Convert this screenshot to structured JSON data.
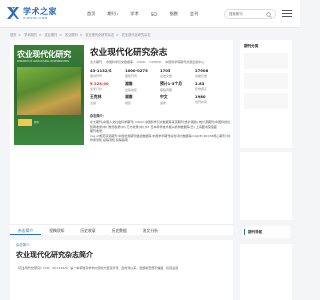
{
  "header": {
    "logo_cn": "学术之家",
    "logo_en": "XUESHU.COM",
    "nav": [
      {
        "label": "首页",
        "dropdown": false
      },
      {
        "label": "期刊",
        "dropdown": true
      },
      {
        "label": "学术",
        "dropdown": false
      },
      {
        "label": "SCI",
        "dropdown": false
      },
      {
        "label": "指数",
        "dropdown": false
      },
      {
        "label": "会刊",
        "dropdown": false
      }
    ],
    "search_placeholder": "搜索期刊"
  },
  "breadcrumb": [
    "首页",
    "学术期刊",
    "农业期刊",
    "农业期刊",
    "农业现代化研究杂志",
    "农业现代化研究杂志"
  ],
  "journal": {
    "title": "农业现代化研究杂志",
    "tags": [
      "北大期刊",
      "中国科学引文数据库",
      "CSCD",
      "CSTPCD",
      "中国科学院期刊文献出版中心"
    ],
    "cover_title": "农业现代化研究",
    "cover_sub": "RESEARCH OF AGRICULTURAL MODERNIZATION",
    "cover_band": "期刊",
    "stats": [
      {
        "value": "43-1132/S",
        "label": "国内刊号"
      },
      {
        "value": "1000-0275",
        "label": "国际刊号"
      },
      {
        "value": "1705",
        "label": "总发文量"
      },
      {
        "value": "27908",
        "label": "总被引量"
      },
      {
        "value": "¥ 228.00",
        "label": "全年订价",
        "red": true
      },
      {
        "value": "湖南",
        "label": "出版地区"
      },
      {
        "value": "预计1-3个月",
        "label": "审稿周期"
      },
      {
        "value": "2.83",
        "label": "影响因子"
      },
      {
        "value": "王克林",
        "label": "主编"
      },
      {
        "value": "湖南",
        "label": "地区"
      },
      {
        "value": "中文",
        "label": "语言"
      },
      {
        "value": "1980",
        "label": "创刊时间"
      }
    ],
    "intro_label": "杂志简介：",
    "intro_lines": [
      "北大期刊(中国人文社会科学期刊)  CSCD 中国科学引文数据库来源期刊(含扩展版)  统计源期刊(中国科技论文优秀期刊)",
      "知网收录(中)  维普收录(中)  万方收录(中)  JST 日本科学技术振兴机构数据库(日)  上海图书馆馆藏",
      "期刊收录：",
      "Caj-cd规范获奖期刊  中国优秀期刊遴选数据库  中国学术期刊综合评价数据库(CAJCE)  RCCSE核心期刊  中国科技期刊",
      "作者须知  投稿须知  投稿指南"
    ]
  },
  "tabs": [
    "杂志简介",
    "投稿须知",
    "历史收录",
    "历史数据",
    "发文分析"
  ],
  "sidebar": {
    "title": "期刊分类",
    "badge": "期刊导航"
  },
  "section": {
    "tag": "杂志简介",
    "title": "农业现代化研究杂志简介",
    "text": "《农业现代化研究》（CN：43-1132/S）是一本有较高学术价值的大型双月刊，自创刊以来，选题新奇而不偏颇，栏目设置"
  }
}
